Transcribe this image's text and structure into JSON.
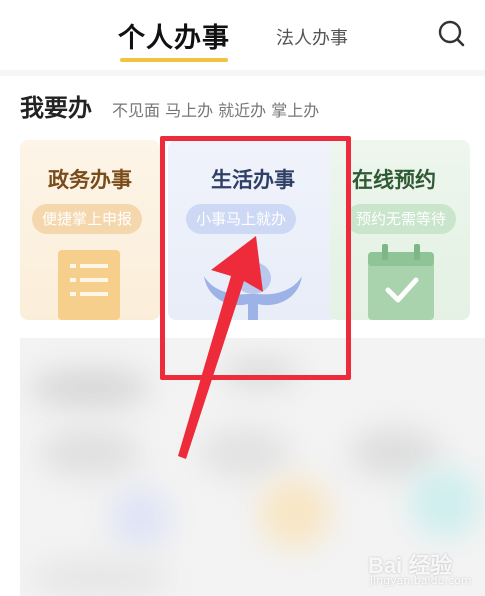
{
  "header": {
    "tabs": [
      {
        "label": "个人办事",
        "active": true
      },
      {
        "label": "法人办事",
        "active": false
      }
    ],
    "search_icon": "search-icon"
  },
  "section": {
    "title": "我要办",
    "subtitle": "不见面 马上办 就近办 掌上办"
  },
  "cards": [
    {
      "title": "政务办事",
      "tag": "便捷掌上申报",
      "icon": "document-icon"
    },
    {
      "title": "生活办事",
      "tag": "小事马上就办",
      "icon": "hands-icon"
    },
    {
      "title": "在线预约",
      "tag": "预约无需等待",
      "icon": "calendar-icon"
    }
  ],
  "watermark": {
    "text": "Bai 经验",
    "sub": "jingyan.baidu.com"
  },
  "colors": {
    "accent": "#f2c341",
    "highlight": "#ee2b3a"
  }
}
